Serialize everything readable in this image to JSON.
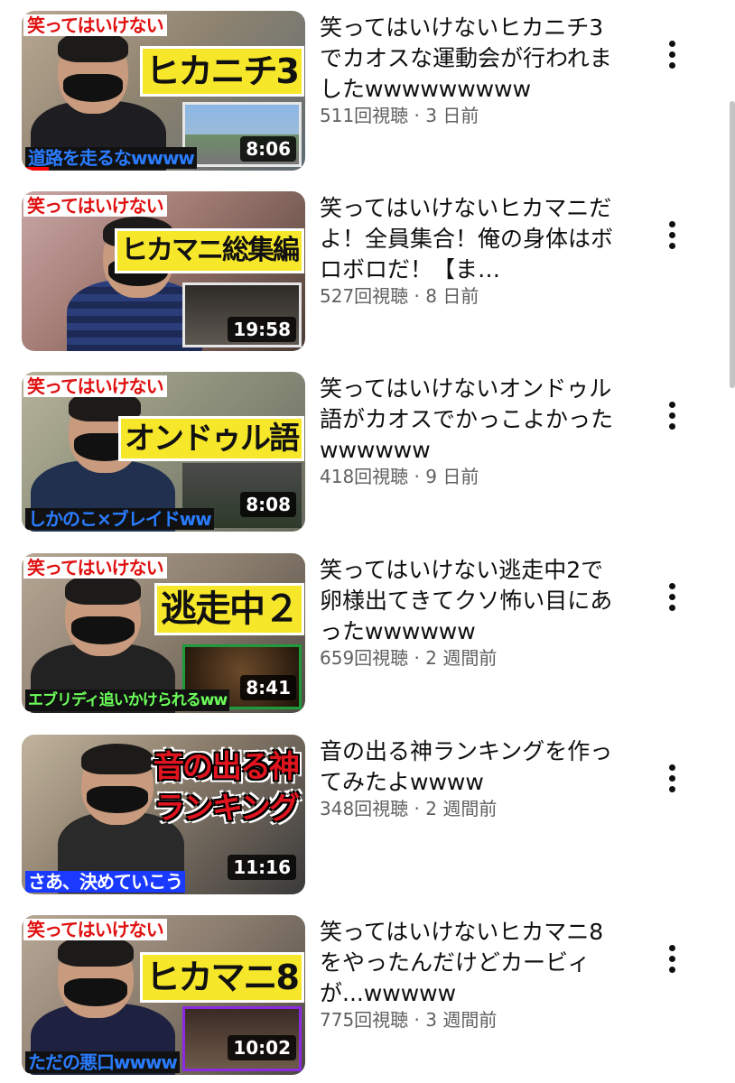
{
  "videos": [
    {
      "title": "笑ってはいけないヒカニチ3でカオスな運動会が行われましたwwwwwwwww",
      "views": "511回視聴",
      "age": "3 日前",
      "duration": "8:06",
      "thumb": {
        "badge": "笑ってはいけない",
        "caption": "ヒカニチ3",
        "subcaption": "道路を走るなwwww"
      }
    },
    {
      "title": "笑ってはいけないヒカマニだよ！全員集合！俺の身体はボロボロだ！【ま…",
      "views": "527回視聴",
      "age": "8 日前",
      "duration": "19:58",
      "thumb": {
        "badge": "笑ってはいけない",
        "caption": "ヒカマニ総集編",
        "subcaption": ""
      }
    },
    {
      "title": "笑ってはいけないオンドゥル語がカオスでかっこよかったwwwwww",
      "views": "418回視聴",
      "age": "9 日前",
      "duration": "8:08",
      "thumb": {
        "badge": "笑ってはいけない",
        "caption": "オンドゥル語",
        "subcaption": "しかのこ×ブレイドww"
      }
    },
    {
      "title": "笑ってはいけない逃走中2で卵様出てきてクソ怖い目にあったwwwwww",
      "views": "659回視聴",
      "age": "2 週間前",
      "duration": "8:41",
      "thumb": {
        "badge": "笑ってはいけない",
        "caption": "逃走中２",
        "subcaption": "エブリディ追いかけられるww"
      }
    },
    {
      "title": "音の出る神ランキングを作ってみたよwwww",
      "views": "348回視聴",
      "age": "2 週間前",
      "duration": "11:16",
      "thumb": {
        "badge": "",
        "caption": "音の出る神",
        "caption2": "ランキング",
        "subcaption": "さあ、決めていこう"
      }
    },
    {
      "title": "笑ってはいけないヒカマニ8をやったんだけどカービィが...wwwww",
      "views": "775回視聴",
      "age": "3 週間前",
      "duration": "10:02",
      "thumb": {
        "badge": "笑ってはいけない",
        "caption": "ヒカマニ8",
        "subcaption": "ただの悪口wwww"
      }
    }
  ],
  "meta_separator": "·",
  "colors": {
    "progress": "#ff0000",
    "meta_text": "#606060",
    "title_text": "#0f0f0f"
  },
  "icons": {
    "more": "three-dot-vertical-icon"
  }
}
